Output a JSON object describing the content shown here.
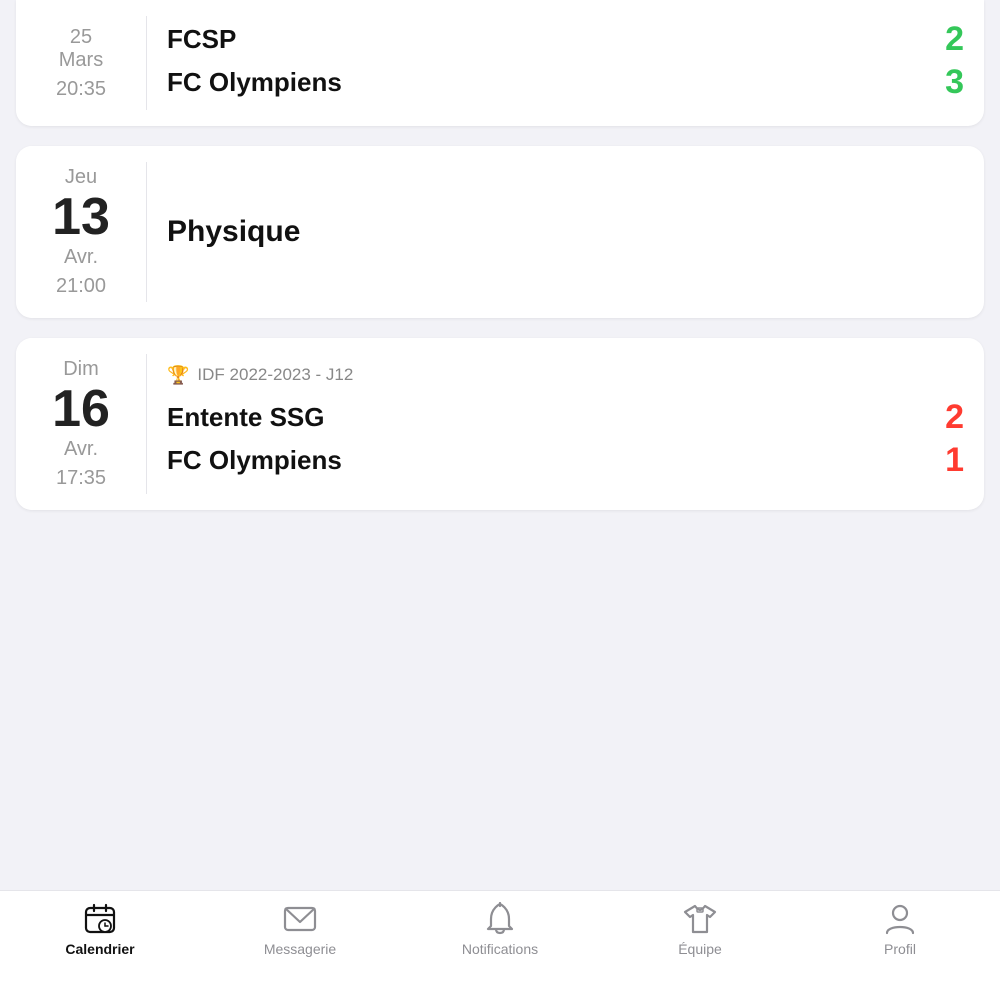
{
  "cards": [
    {
      "id": "card-top-partial",
      "date": {
        "day_name": "25",
        "day_num": "",
        "month": "Mars",
        "time": "20:35",
        "partial_label": "25 Mars 20:35"
      },
      "type": "match",
      "league": null,
      "teams": [
        {
          "name": "FCSP",
          "score": "2",
          "score_color": "green"
        },
        {
          "name": "FC Olympiens",
          "score": "3",
          "score_color": "green"
        }
      ]
    },
    {
      "id": "card-physique",
      "date": {
        "day_name": "Jeu",
        "day_num": "13",
        "month": "Avr.",
        "time": "21:00"
      },
      "type": "physique",
      "league": null,
      "label": "Physique"
    },
    {
      "id": "card-match2",
      "date": {
        "day_name": "Dim",
        "day_num": "16",
        "month": "Avr.",
        "time": "17:35"
      },
      "type": "match",
      "league": "IDF 2022-2023 - J12",
      "teams": [
        {
          "name": "Entente SSG",
          "score": "2",
          "score_color": "red"
        },
        {
          "name": "FC Olympiens",
          "score": "1",
          "score_color": "red"
        }
      ]
    }
  ],
  "nav": {
    "items": [
      {
        "id": "calendrier",
        "label": "Calendrier",
        "active": true
      },
      {
        "id": "messagerie",
        "label": "Messagerie",
        "active": false
      },
      {
        "id": "notifications",
        "label": "Notifications",
        "active": false
      },
      {
        "id": "equipe",
        "label": "Équipe",
        "active": false
      },
      {
        "id": "profil",
        "label": "Profil",
        "active": false
      }
    ]
  }
}
